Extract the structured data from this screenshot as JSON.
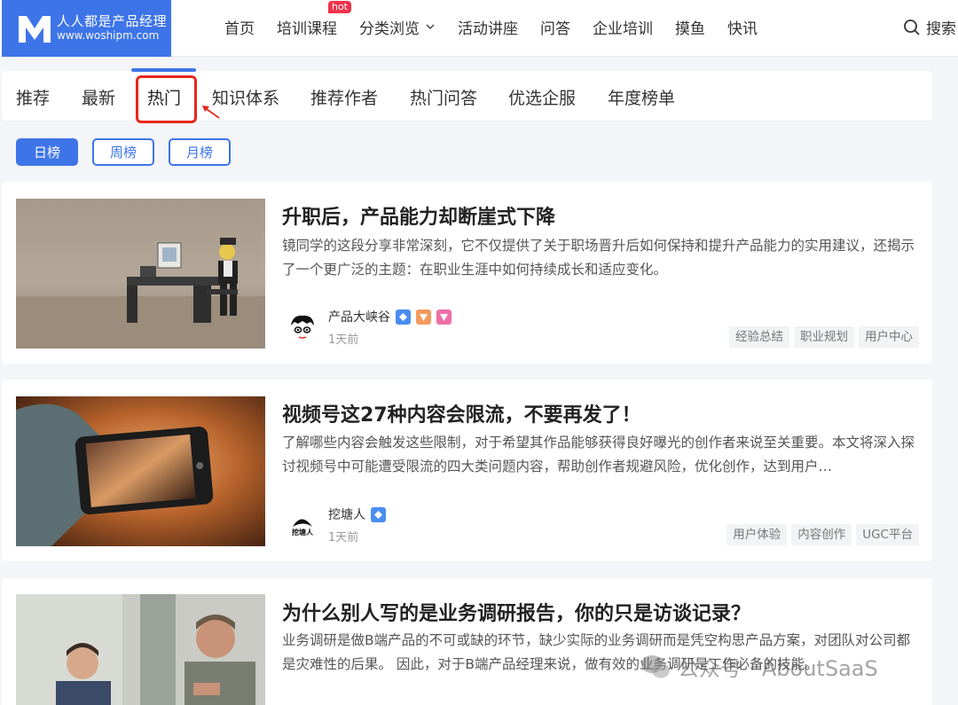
{
  "header": {
    "logo_cn": "人人都是产品经理",
    "logo_en": "www.woshipm.com",
    "nav": [
      {
        "label": "首页"
      },
      {
        "label": "培训课程",
        "badge": "hot"
      },
      {
        "label": "分类浏览",
        "dropdown": true
      },
      {
        "label": "活动讲座"
      },
      {
        "label": "问答"
      },
      {
        "label": "企业培训"
      },
      {
        "label": "摸鱼"
      },
      {
        "label": "快讯"
      }
    ],
    "search_label": "搜索"
  },
  "tabs": [
    "推荐",
    "最新",
    "热门",
    "知识体系",
    "推荐作者",
    "热门问答",
    "优选企服",
    "年度榜单"
  ],
  "active_tab": "热门",
  "ranges": [
    "日榜",
    "周榜",
    "月榜"
  ],
  "active_range": "日榜",
  "articles": [
    {
      "title": "升职后，产品能力却断崖式下降",
      "desc": "镜同学的这段分享非常深刻，它不仅提供了关于职场晋升后如何保持和提升产品能力的实用建议，还揭示了一个更广泛的主题：在职业生涯中如何持续成长和适应变化。",
      "author": "产品大峡谷",
      "time": "1天前",
      "tags": [
        "经验总结",
        "职业规划",
        "用户中心"
      ]
    },
    {
      "title": "视频号这27种内容会限流，不要再发了！",
      "desc": "了解哪些内容会触发这些限制，对于希望其作品能够获得良好曝光的创作者来说至关重要。本文将深入探讨视频号中可能遭受限流的四大类问题内容，帮助创作者规避风险，优化创作，达到用户…",
      "author": "挖塘人",
      "avatar_text": "挖塘人",
      "time": "1天前",
      "tags": [
        "用户体验",
        "内容创作",
        "UGC平台"
      ]
    },
    {
      "title": "为什么别人写的是业务调研报告，你的只是访谈记录？",
      "desc": "业务调研是做B端产品的不可或缺的环节，缺少实际的业务调研而是凭空构思产品方案，对团队对公司都是灾难性的后果。 因此，对于B端产品经理来说，做有效的业务调研是工作必备的技能。"
    }
  ],
  "watermark": "公众号 · AboutSaaS",
  "colors": {
    "brand": "#3d74e8",
    "hot": "#f0334a",
    "annotation": "#e8261c"
  }
}
